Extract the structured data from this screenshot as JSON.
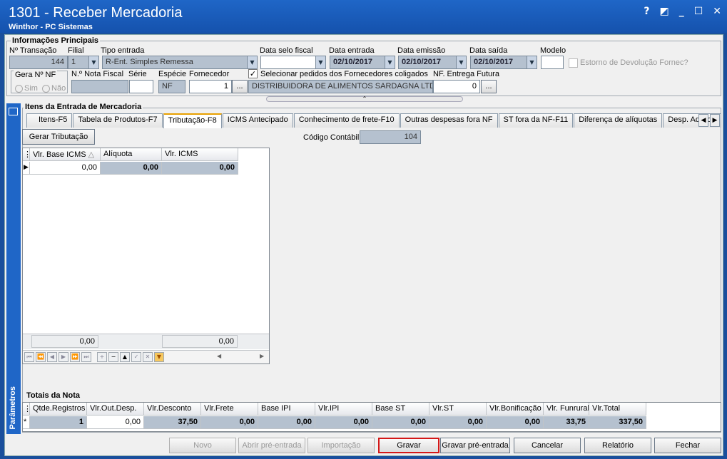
{
  "window": {
    "title": "1301 - Receber Mercadoria",
    "subtitle": "Winthor - PC Sistemas",
    "help": "?",
    "minimize": "_",
    "maximize": "☐",
    "close": "✕"
  },
  "info": {
    "group_title": "Informações Principais",
    "transacao_label": "Nº Transação",
    "transacao": "144",
    "filial_label": "Filial",
    "filial": "1",
    "tipo_label": "Tipo entrada",
    "tipo": "R-Ent. Simples Remessa",
    "data_selo_label": "Data selo fiscal",
    "data_selo": "",
    "data_entrada_label": "Data entrada",
    "data_entrada": "02/10/2017",
    "data_emissao_label": "Data emissão",
    "data_emissao": "02/10/2017",
    "data_saida_label": "Data saída",
    "data_saida": "02/10/2017",
    "modelo_label": "Modelo",
    "modelo": "",
    "estorno_label": "Estorno de Devolução Fornec?",
    "gera_nf_label": "Gera Nº NF",
    "sim_label": "Sim",
    "nao_label": "Não",
    "nota_label": "N.º Nota Fiscal",
    "nota": "",
    "serie_label": "Série",
    "serie": "",
    "especie_label": "Espécie",
    "especie": "NF",
    "fornecedor_label": "Fornecedor",
    "fornecedor": "1",
    "fornecedor_btn": "...",
    "fornecedor_nome": "DISTRIBUIDORA DE ALIMENTOS SARDAGNA LTDA",
    "coligados_label": "Selecionar pedidos dos Fornecedores coligados",
    "nf_futura_label": "NF. Entrega Futura",
    "nf_futura": "0",
    "nf_futura_btn": "..."
  },
  "itens": {
    "group_title": "Itens da Entrada de Mercadoria",
    "tabs": [
      "Itens-F5",
      "Tabela de Produtos-F7",
      "Tributação-F8",
      "ICMS Antecipado",
      "Conhecimento de frete-F10",
      "Outras despesas fora NF",
      "ST fora da NF-F11",
      "Diferença de alíquotas",
      "Desp. Adicion"
    ],
    "gerar_btn": "Gerar Tributação",
    "codigo_label": "Código Contábil",
    "codigo": "104",
    "grid": {
      "headers": [
        "Vlr. Base ICMS",
        "Alíquota",
        "Vlr. ICMS"
      ],
      "row": [
        "0,00",
        "0,00",
        "0,00"
      ],
      "footer": [
        "0,00",
        "",
        "0,00"
      ]
    }
  },
  "sidebar_label": "Parâmetros",
  "totais": {
    "title": "Totais da Nota",
    "headers": [
      "Qtde.Registros",
      "Vlr.Out.Desp.",
      "Vlr.Desconto",
      "Vlr.Frete",
      "Base IPI",
      "Vlr.IPI",
      "Base ST",
      "Vlr.ST",
      "Vlr.Bonificação",
      "Vlr. Funrural",
      "Vlr.Total"
    ],
    "row": [
      "1",
      "0,00",
      "37,50",
      "0,00",
      "0,00",
      "0,00",
      "0,00",
      "0,00",
      "0,00",
      "33,75",
      "337,50"
    ]
  },
  "buttons": {
    "novo": "Novo",
    "abrir": "Abrir pré-entrada",
    "importacao": "Importação",
    "gravar": "Gravar",
    "gravar_pre": "Gravar pré-entrada",
    "cancelar": "Cancelar",
    "relatorio": "Relatório",
    "fechar": "Fechar"
  }
}
